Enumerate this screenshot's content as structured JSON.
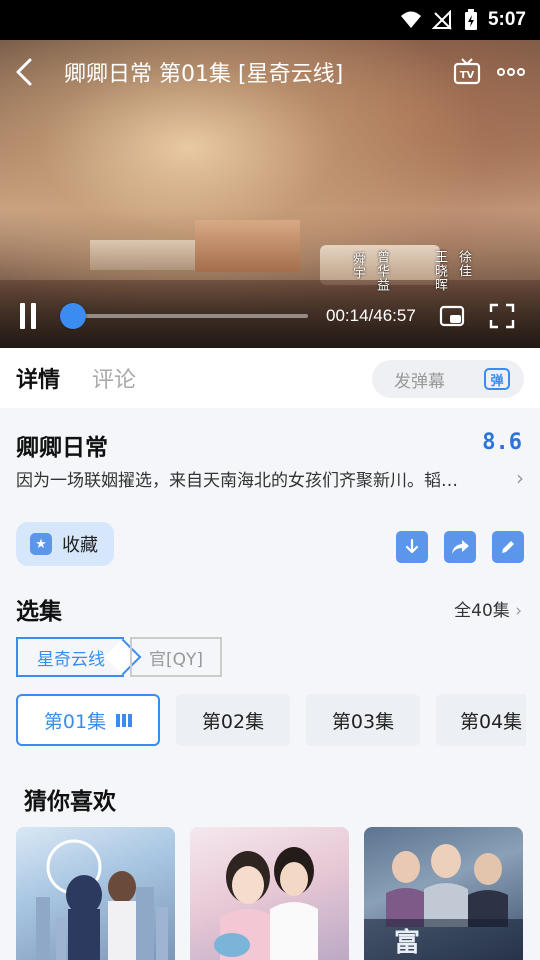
{
  "status_bar": {
    "time": "5:07"
  },
  "player": {
    "title": "卿卿日常 第01集 [星奇云线]",
    "time_display": "00:14/46:57",
    "progress_fraction": 0.005,
    "credits": [
      "王晓晖",
      "徐佳",
      "曾华益",
      "舜宇"
    ]
  },
  "tabs": [
    {
      "label": "详情",
      "active": true
    },
    {
      "label": "评论",
      "active": false
    }
  ],
  "danmaku": {
    "placeholder": "发弹幕",
    "icon_label": "弹"
  },
  "show": {
    "title": "卿卿日常",
    "rating": "8.6",
    "description": "因为一场联姻擢选，来自天南海北的女孩们齐聚新川。韬…"
  },
  "actions": {
    "favorite_label": "收藏"
  },
  "episodes": {
    "header": "选集",
    "total": "全40集",
    "sources": [
      "星奇云线",
      "官[QY]"
    ],
    "items": [
      "第01集",
      "第02集",
      "第03集",
      "第04集"
    ]
  },
  "recommend": {
    "header": "猜你喜欢"
  },
  "colors": {
    "accent": "#3a8cf0",
    "rating": "#2d74d9"
  }
}
